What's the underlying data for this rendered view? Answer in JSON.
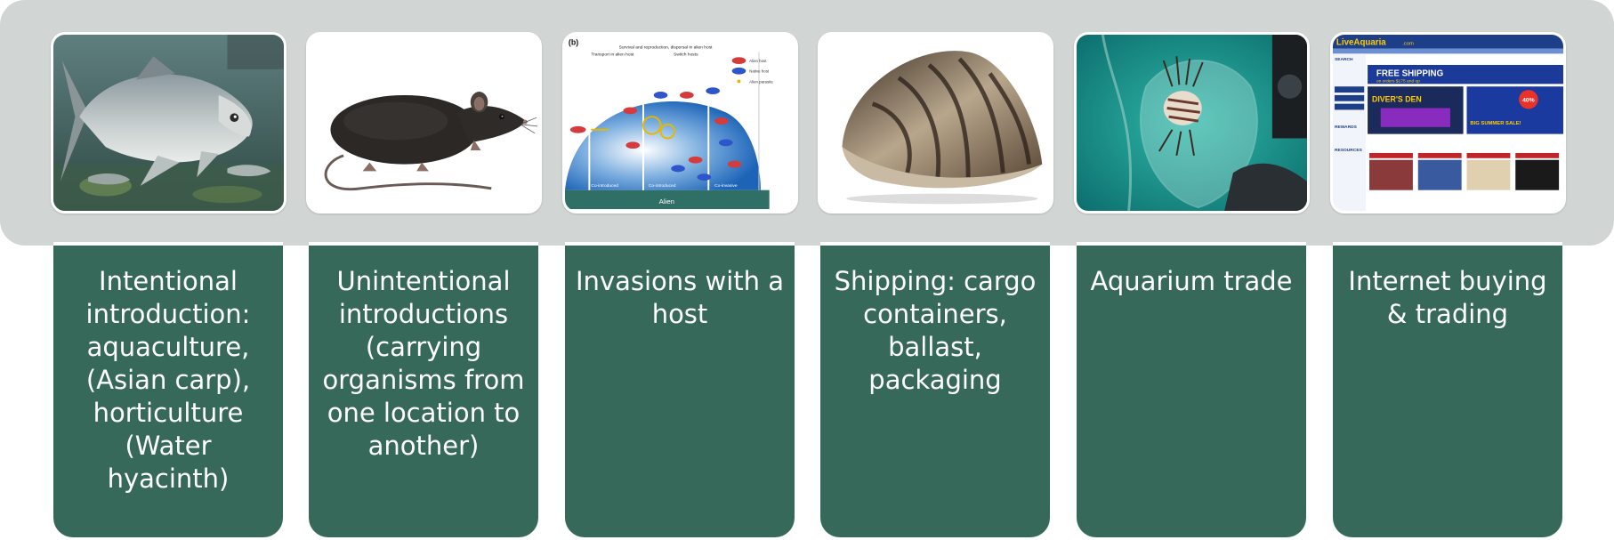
{
  "columns": [
    {
      "id": "intentional",
      "icon": "asian-carp-image",
      "label": "Intentional introduction: aquaculture, (Asian carp), horticulture (Water hyacinth)"
    },
    {
      "id": "unintentional",
      "icon": "rat-image",
      "label": "Unintentional introductions (carrying organisms from one location to another)"
    },
    {
      "id": "host",
      "icon": "host-invasion-diagram",
      "label": "Invasions with a host"
    },
    {
      "id": "shipping",
      "icon": "zebra-mussel-image",
      "label": "Shipping: cargo containers, ballast, packaging"
    },
    {
      "id": "aquarium",
      "icon": "lionfish-bag-image",
      "label": "Aquarium trade"
    },
    {
      "id": "internet",
      "icon": "aquarium-website-image",
      "label": "Internet buying & trading"
    }
  ],
  "host_diagram": {
    "panel_letter": "(b)",
    "stages": [
      "Transport in alien host",
      "Survival and reproduction, dispersal in alien host",
      "Switch hosts"
    ],
    "legend": [
      "Alien host",
      "Native host",
      "Alien parasite"
    ],
    "bottom_labels": [
      "Co-introduced",
      "Co-introduced",
      "Co-invasive"
    ],
    "base_label": "Alien"
  },
  "website": {
    "brand": "LiveAquaria",
    "brand_suffix": ".com",
    "banner_1": "FREE SHIPPING",
    "banner_1_sub": "on orders $175 and up",
    "promo_left": "DIVER'S DEN",
    "promo_right_pct": "40%",
    "promo_right": "BIG SUMMER SALE!",
    "side_heading_1": "SEARCH",
    "side_heading_2": "REWARDS",
    "side_heading_3": "RESOURCES"
  },
  "colors": {
    "band": "#d1d5d4",
    "card": "#37695b",
    "card_text": "#ffffff"
  }
}
